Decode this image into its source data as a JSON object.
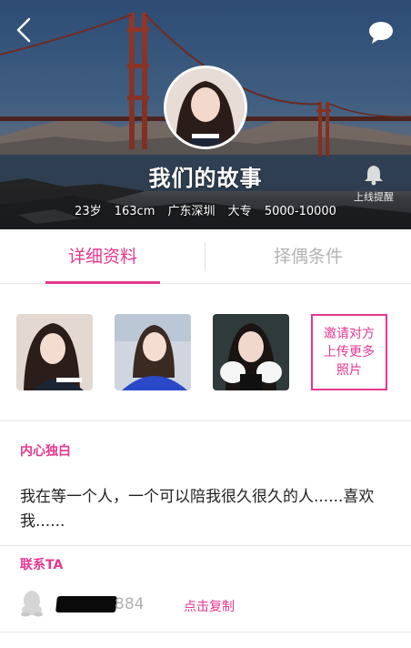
{
  "header": {
    "name": "我们的故事",
    "meta": [
      "23岁",
      "163cm",
      "广东深圳",
      "大专",
      "5000-10000"
    ],
    "online_remind_label": "上线提醒",
    "back_icon": "chevron-left-icon",
    "message_icon": "chat-bubble-icon",
    "remind_icon": "bell-icon"
  },
  "tabs": [
    {
      "label": "详细资料",
      "active": true
    },
    {
      "label": "择偶条件",
      "active": false
    }
  ],
  "photos": {
    "count": 3,
    "invite_lines": [
      "邀请对方",
      "上传更多",
      "照片"
    ]
  },
  "monologue": {
    "title": "内心独白",
    "text": "我在等一个人，一个可以陪我很久很久的人......喜欢我......"
  },
  "contact": {
    "title": "联系TA",
    "number_visible": "884",
    "copy_label": "点击复制",
    "icon": "qq-penguin-icon"
  },
  "colors": {
    "accent": "#e6378f",
    "inactive_tab": "#b3b3b3"
  }
}
